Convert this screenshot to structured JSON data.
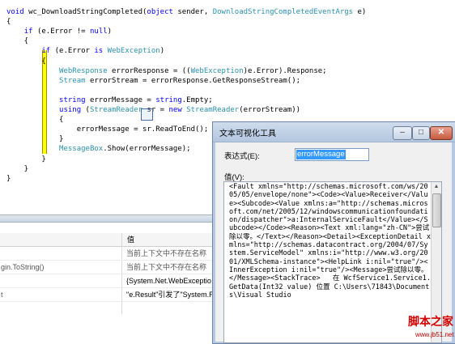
{
  "code": {
    "lines": [
      {
        "tokens": [
          {
            "t": "void",
            "c": "kw"
          },
          {
            "t": " wc_DownloadStringCompleted("
          },
          {
            "t": "object",
            "c": "kw"
          },
          {
            "t": " sender, "
          },
          {
            "t": "DownloadStringCompletedEventArgs",
            "c": "ty"
          },
          {
            "t": " e)"
          }
        ]
      },
      {
        "tokens": [
          {
            "t": "{"
          }
        ]
      },
      {
        "tokens": [
          {
            "t": "    "
          },
          {
            "t": "if",
            "c": "kw"
          },
          {
            "t": " (e.Error != "
          },
          {
            "t": "null",
            "c": "kw"
          },
          {
            "t": ")"
          }
        ]
      },
      {
        "tokens": [
          {
            "t": "    {"
          }
        ]
      },
      {
        "tokens": [
          {
            "t": "        "
          },
          {
            "t": "if",
            "c": "kw"
          },
          {
            "t": " (e.Error "
          },
          {
            "t": "is",
            "c": "kw"
          },
          {
            "t": " "
          },
          {
            "t": "WebException",
            "c": "ty"
          },
          {
            "t": ")"
          }
        ]
      },
      {
        "tokens": [
          {
            "t": "        {"
          }
        ]
      },
      {
        "tokens": [
          {
            "t": "            "
          },
          {
            "t": "WebResponse",
            "c": "ty"
          },
          {
            "t": " errorResponse = (("
          },
          {
            "t": "WebException",
            "c": "ty"
          },
          {
            "t": ")e.Error).Response;"
          }
        ]
      },
      {
        "tokens": [
          {
            "t": "            "
          },
          {
            "t": "Stream",
            "c": "ty"
          },
          {
            "t": " errorStream = errorResponse.GetResponseStream();"
          }
        ]
      },
      {
        "tokens": []
      },
      {
        "tokens": [
          {
            "t": "            "
          },
          {
            "t": "string",
            "c": "kw"
          },
          {
            "t": " errorMessage = "
          },
          {
            "t": "string",
            "c": "kw"
          },
          {
            "t": ".Empty;"
          }
        ]
      },
      {
        "tokens": [
          {
            "t": "            "
          },
          {
            "t": "using",
            "c": "kw"
          },
          {
            "t": " ("
          },
          {
            "t": "StreamReader",
            "c": "ty"
          },
          {
            "t": " sr = "
          },
          {
            "t": "new",
            "c": "kw"
          },
          {
            "t": " "
          },
          {
            "t": "StreamReader",
            "c": "ty"
          },
          {
            "t": "(errorStream))"
          }
        ]
      },
      {
        "tokens": [
          {
            "t": "            {"
          }
        ]
      },
      {
        "tokens": [
          {
            "t": "                errorMessage = sr.ReadToEnd();"
          }
        ]
      },
      {
        "tokens": [
          {
            "t": "            }"
          }
        ]
      },
      {
        "tokens": [
          {
            "t": "            "
          },
          {
            "t": "MessageBox",
            "c": "ty"
          },
          {
            "t": ".Show(errorMessage);"
          }
        ]
      },
      {
        "tokens": [
          {
            "t": "        }"
          }
        ]
      },
      {
        "tokens": [
          {
            "t": "    }"
          }
        ]
      },
      {
        "tokens": [
          {
            "t": "}"
          }
        ]
      }
    ]
  },
  "locals": {
    "value_header": "值",
    "rows": [
      {
        "name": "",
        "value": "当前上下文中不存在名称"
      },
      {
        "name": "gin.ToString()",
        "value": "当前上下文中不存在名称"
      },
      {
        "name": "",
        "value": "{System.Net.WebExceptio"
      },
      {
        "name": "t",
        "value": "\"e.Result\"引发了\"System.R"
      }
    ]
  },
  "dialog": {
    "title": "文本可视化工具",
    "min_label": "–",
    "max_label": "□",
    "close_label": "✕",
    "expression_label": "表达式(E):",
    "expression_value": "errorMessage",
    "value_label": "值(V):",
    "value_text": "<Fault xmlns=\"http://schemas.microsoft.com/ws/2005/05/envelope/none\"><Code><Value>Receiver</Value><Subcode><Value xmlns:a=\"http://schemas.microsoft.com/net/2005/12/windowscommunicationfoundation/dispatcher\">a:InternalServiceFault</Value></Subcode></Code><Reason><Text xml:lang=\"zh-CN\">尝试除以零。</Text></Reason><Detail><ExceptionDetail xmlns=\"http://schemas.datacontract.org/2004/07/System.ServiceModel\" xmlns:i=\"http://www.w3.org/2001/XMLSchema-instance\"><HelpLink i:nil=\"true\"/><InnerException i:nil=\"true\"/><Message>尝试除以零。</Message><StackTrace>   在 WcfService1.Service1.GetData(Int32 value) 位置 C:\\Users\\71843\\Documents\\Visual Studio"
  },
  "watermark": {
    "main": "脚本之家",
    "sub": "www.jb51.net"
  }
}
